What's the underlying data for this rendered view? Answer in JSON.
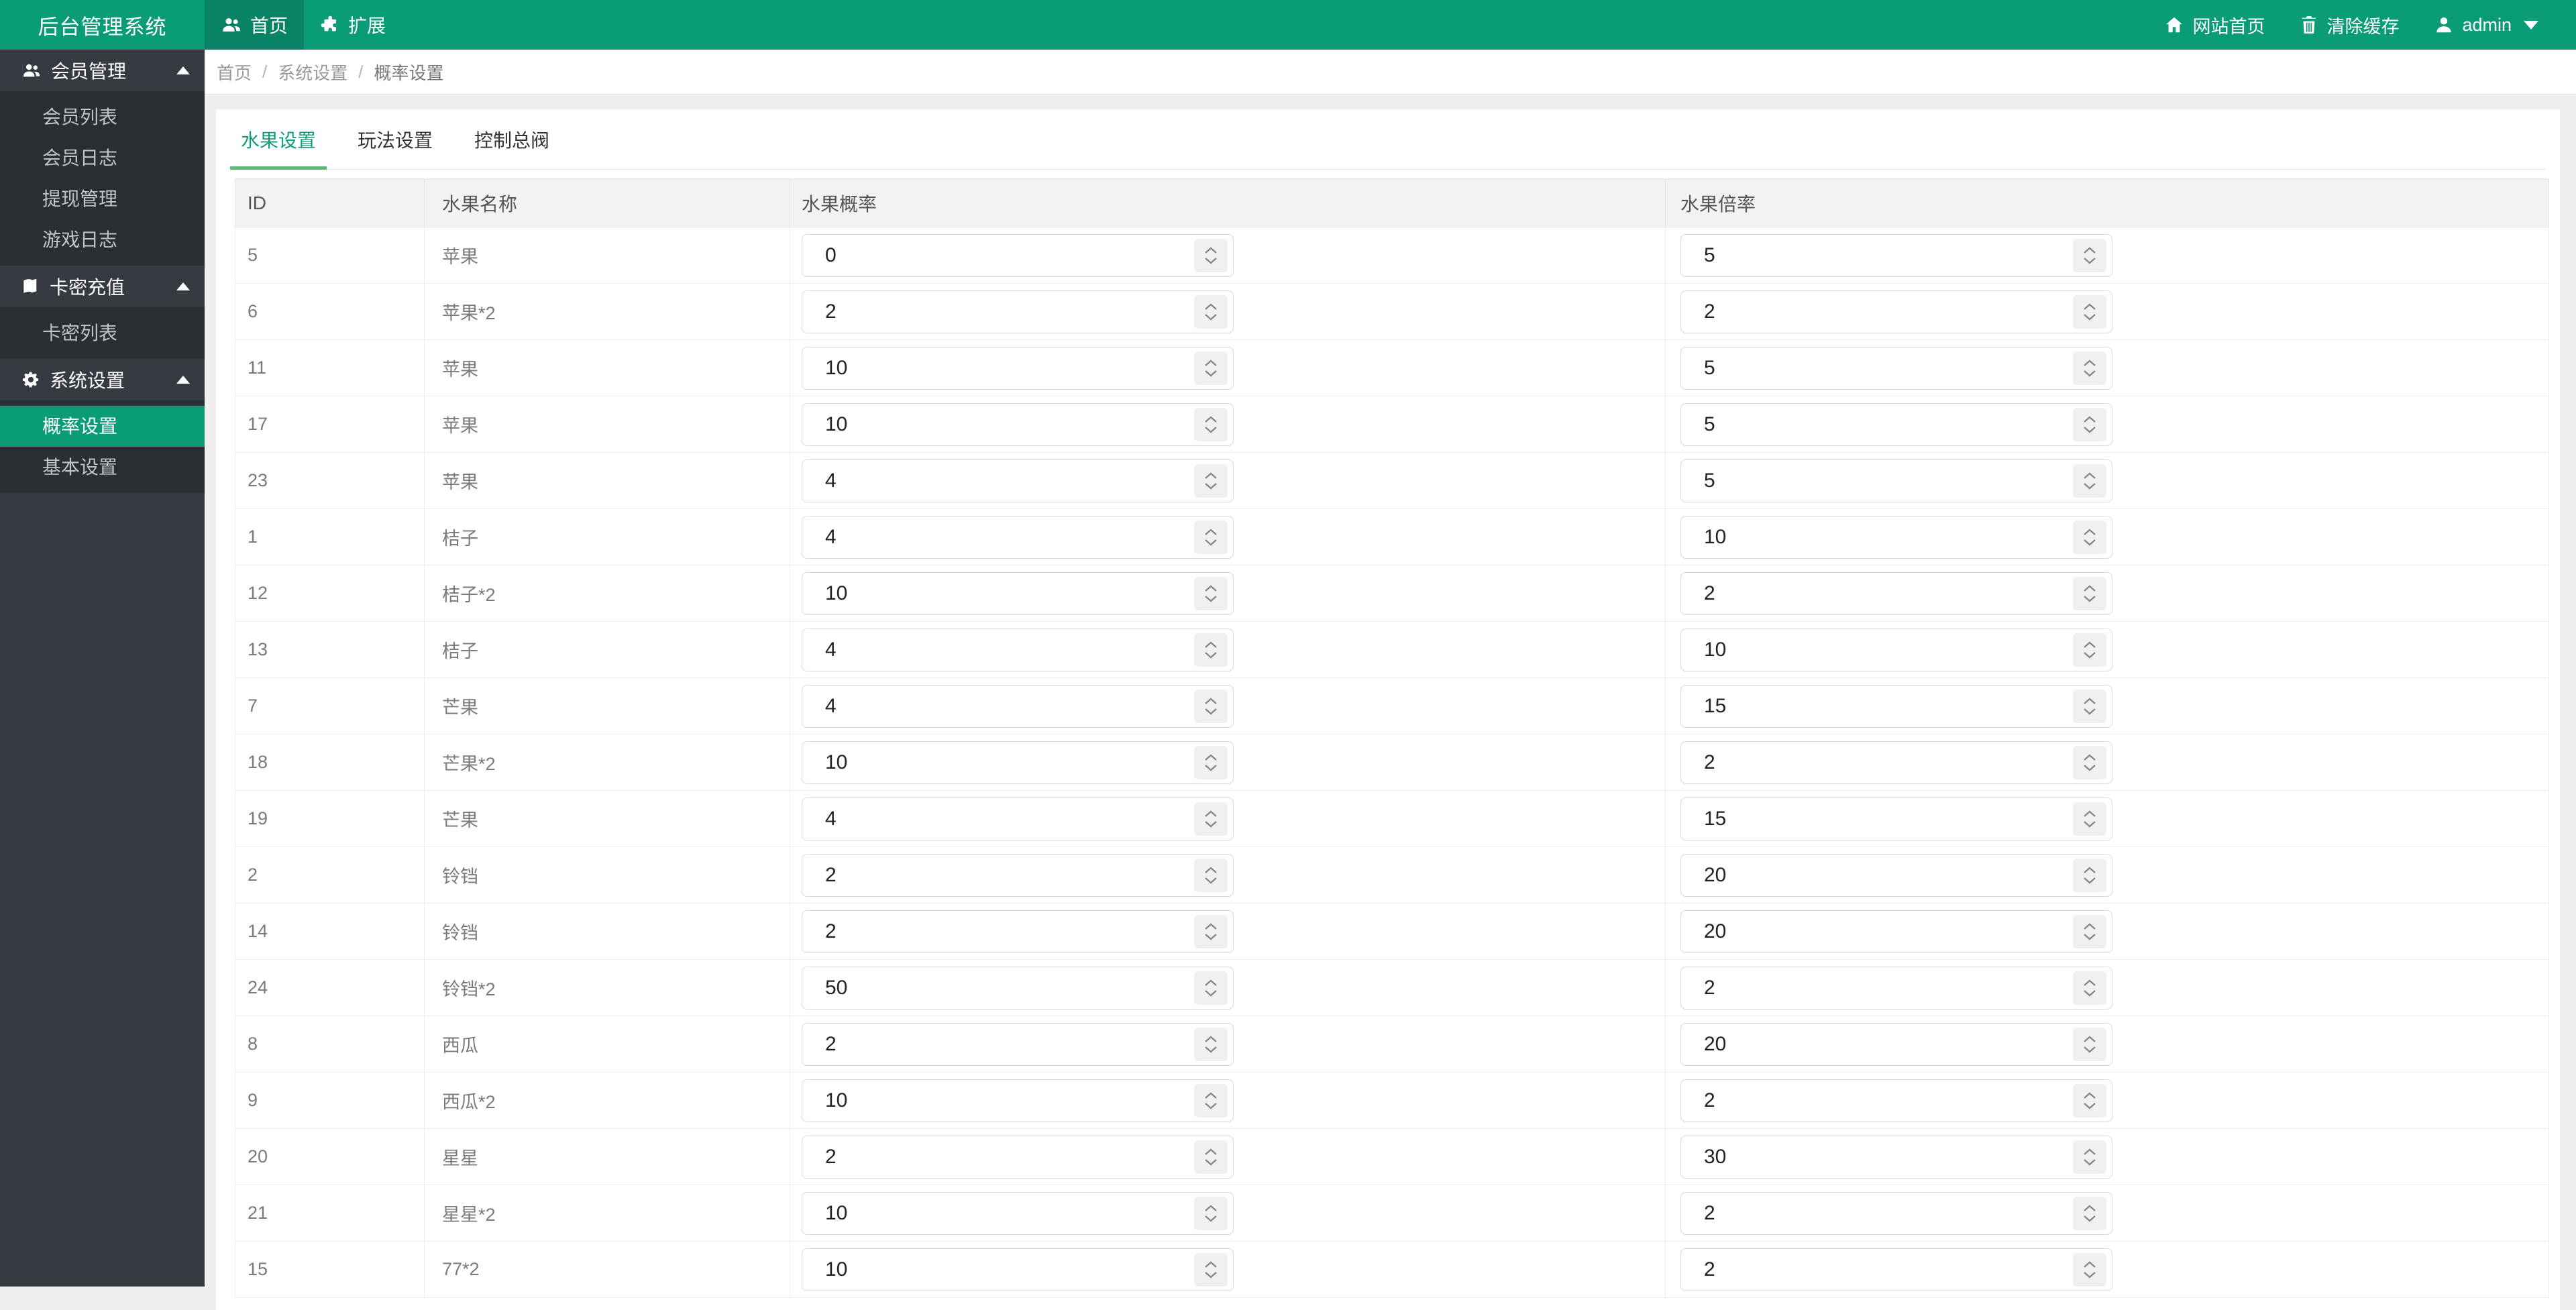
{
  "app": {
    "title": "后台管理系统"
  },
  "navbar": {
    "tabs": [
      {
        "label": "首页",
        "icon": "users-icon",
        "active": true
      },
      {
        "label": "扩展",
        "icon": "puzzle-icon",
        "active": false
      }
    ],
    "right": [
      {
        "label": "网站首页",
        "icon": "home-icon"
      },
      {
        "label": "清除缓存",
        "icon": "trash-icon"
      }
    ],
    "user": {
      "name": "admin",
      "icon": "user-icon"
    }
  },
  "sidebar": {
    "groups": [
      {
        "label": "会员管理",
        "icon": "users-icon",
        "expanded": true,
        "items": [
          {
            "label": "会员列表"
          },
          {
            "label": "会员日志"
          },
          {
            "label": "提现管理"
          },
          {
            "label": "游戏日志"
          }
        ]
      },
      {
        "label": "卡密充值",
        "icon": "book-icon",
        "expanded": true,
        "items": [
          {
            "label": "卡密列表"
          }
        ]
      },
      {
        "label": "系统设置",
        "icon": "gear-icon",
        "expanded": true,
        "items": [
          {
            "label": "概率设置",
            "active": true
          },
          {
            "label": "基本设置"
          }
        ]
      }
    ]
  },
  "breadcrumb": {
    "items": [
      "首页",
      "系统设置",
      "概率设置"
    ],
    "separator": "/"
  },
  "main": {
    "tabs": [
      {
        "label": "水果设置",
        "active": true
      },
      {
        "label": "玩法设置",
        "active": false
      },
      {
        "label": "控制总阀",
        "active": false
      }
    ],
    "table": {
      "columns": [
        "ID",
        "水果名称",
        "水果概率",
        "水果倍率"
      ],
      "rows": [
        {
          "id": "5",
          "name": "苹果",
          "prob": "0",
          "rate": "5"
        },
        {
          "id": "6",
          "name": "苹果*2",
          "prob": "2",
          "rate": "2"
        },
        {
          "id": "11",
          "name": "苹果",
          "prob": "10",
          "rate": "5"
        },
        {
          "id": "17",
          "name": "苹果",
          "prob": "10",
          "rate": "5"
        },
        {
          "id": "23",
          "name": "苹果",
          "prob": "4",
          "rate": "5"
        },
        {
          "id": "1",
          "name": "桔子",
          "prob": "4",
          "rate": "10"
        },
        {
          "id": "12",
          "name": "桔子*2",
          "prob": "10",
          "rate": "2"
        },
        {
          "id": "13",
          "name": "桔子",
          "prob": "4",
          "rate": "10"
        },
        {
          "id": "7",
          "name": "芒果",
          "prob": "4",
          "rate": "15"
        },
        {
          "id": "18",
          "name": "芒果*2",
          "prob": "10",
          "rate": "2"
        },
        {
          "id": "19",
          "name": "芒果",
          "prob": "4",
          "rate": "15"
        },
        {
          "id": "2",
          "name": "铃铛",
          "prob": "2",
          "rate": "20"
        },
        {
          "id": "14",
          "name": "铃铛",
          "prob": "2",
          "rate": "20"
        },
        {
          "id": "24",
          "name": "铃铛*2",
          "prob": "50",
          "rate": "2"
        },
        {
          "id": "8",
          "name": "西瓜",
          "prob": "2",
          "rate": "20"
        },
        {
          "id": "9",
          "name": "西瓜*2",
          "prob": "10",
          "rate": "2"
        },
        {
          "id": "20",
          "name": "星星",
          "prob": "2",
          "rate": "30"
        },
        {
          "id": "21",
          "name": "星星*2",
          "prob": "10",
          "rate": "2"
        },
        {
          "id": "15",
          "name": "77*2",
          "prob": "10",
          "rate": "2"
        }
      ]
    }
  },
  "colors": {
    "accent_green": "#0a9c77",
    "tab_underline_green": "#5fb878",
    "sidebar_bg": "#353b40",
    "sidebar_submenu_bg": "#2a2f34",
    "content_bg": "#efefef",
    "table_header_bg": "#f2f2f2"
  }
}
